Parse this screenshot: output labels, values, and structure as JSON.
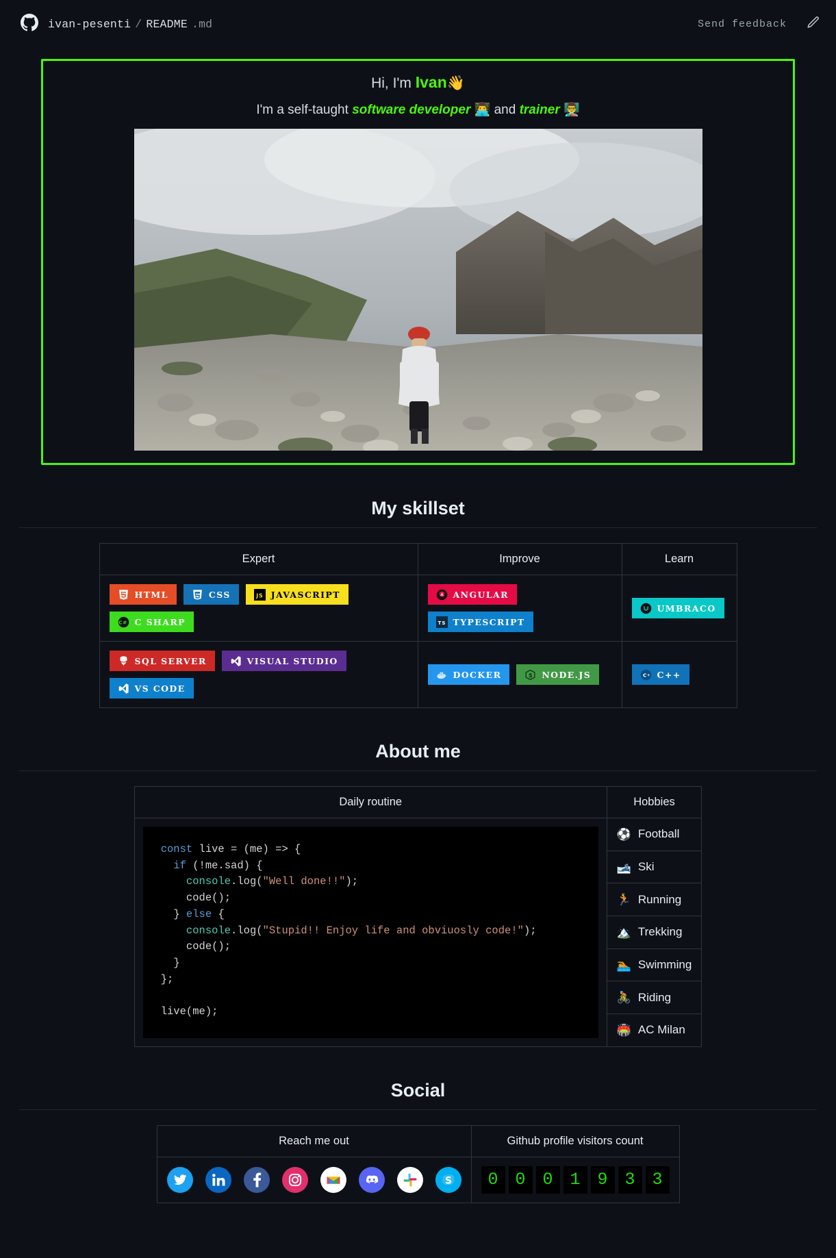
{
  "topbar": {
    "owner": "ivan-pesenti",
    "separator": "/",
    "file": "README",
    "ext": ".md",
    "feedback_label": "Send feedback",
    "logo_icon": "github-octocat-icon",
    "edit_icon": "pencil-icon"
  },
  "hero": {
    "border_color": "#4cf50a",
    "line1_prefix": "Hi, I'm ",
    "line1_name": "Ivan",
    "line1_emoji": "👋",
    "line2_prefix": "I'm a self-taught ",
    "line2_role1": "software developer",
    "line2_emoji1": "👨‍💻",
    "line2_mid": " and ",
    "line2_role2": "trainer",
    "line2_emoji2": "👨‍🏫",
    "photo_alt": "Ivan hiking on a rocky mountain slope with clouds and an alpine lake"
  },
  "skillset": {
    "title": "My skillset",
    "headers": [
      "Expert",
      "Improve",
      "Learn"
    ],
    "expert": [
      [
        {
          "label": "HTML",
          "bg": "#e44d26",
          "icon": "html5-icon"
        },
        {
          "label": "CSS",
          "bg": "#1572b6",
          "icon": "css3-icon"
        },
        {
          "label": "JAVASCRIPT",
          "bg": "#f7df1e",
          "fg": "#000000",
          "icon": "javascript-icon"
        },
        {
          "label": "C SHARP",
          "bg": "#3ddc1f",
          "icon": "csharp-icon"
        }
      ],
      [
        {
          "label": "SQL SERVER",
          "bg": "#cc2927",
          "icon": "sqlserver-icon"
        },
        {
          "label": "VISUAL STUDIO",
          "bg": "#5c2d91",
          "icon": "visualstudio-icon"
        },
        {
          "label": "VS CODE",
          "bg": "#0f80cc",
          "icon": "vscode-icon"
        }
      ]
    ],
    "improve": [
      [
        {
          "label": "ANGULAR",
          "bg": "#e50b45",
          "icon": "angular-icon"
        },
        {
          "label": "TYPESCRIPT",
          "bg": "#0f80cc",
          "icon": "typescript-icon"
        }
      ],
      [
        {
          "label": "DOCKER",
          "bg": "#2496ed",
          "icon": "docker-icon"
        },
        {
          "label": "NODE.JS",
          "bg": "#429945",
          "icon": "nodejs-icon"
        }
      ]
    ],
    "learn": [
      [
        {
          "label": "UMBRACO",
          "bg": "#0ac8c8",
          "icon": "umbraco-icon"
        }
      ],
      [
        {
          "label": "C++",
          "bg": "#1172b8",
          "icon": "cplusplus-icon"
        }
      ]
    ]
  },
  "about": {
    "title": "About me",
    "headers": [
      "Daily routine",
      "Hobbies"
    ],
    "code_lines": [
      {
        "t": "const",
        "c": "k",
        "rest": " live = (me) => {"
      },
      {
        "indent": "  ",
        "t": "if",
        "c": "k",
        "rest": " (!me.sad) {"
      },
      {
        "indent": "    ",
        "t": "console",
        "c": "fn",
        "rest": ".log(",
        "str": "\"Well done!!\"",
        "tail": ");"
      },
      {
        "indent": "    ",
        "plain": "code();"
      },
      {
        "indent": "  ",
        "plain": "} ",
        "t": "else",
        "c": "k",
        "rest": " {"
      },
      {
        "indent": "    ",
        "t": "console",
        "c": "fn",
        "rest": ".log(",
        "str": "\"Stupid!! Enjoy life and obviuosly code!\"",
        "tail": ");"
      },
      {
        "indent": "    ",
        "plain": "code();"
      },
      {
        "indent": "  ",
        "plain": "}"
      },
      {
        "plain": "};"
      },
      {
        "plain": ""
      },
      {
        "plain": "live(me);"
      }
    ],
    "code_text": "const live = (me) => {\n  if (!me.sad) {\n    console.log(\"Well done!!\");\n    code();\n  } else {\n    console.log(\"Stupid!! Enjoy life and obviuosly code!\");\n    code();\n  }\n};\n\nlive(me);",
    "hobbies": [
      {
        "emoji": "⚽",
        "label": "Football",
        "icon": "soccer-ball-icon"
      },
      {
        "emoji": "🎿",
        "label": "Ski",
        "icon": "ski-icon"
      },
      {
        "emoji": "🏃",
        "label": "Running",
        "icon": "runner-icon"
      },
      {
        "emoji": "🏔️",
        "label": "Trekking",
        "icon": "mountain-icon"
      },
      {
        "emoji": "🏊",
        "label": "Swimming",
        "icon": "swimmer-icon"
      },
      {
        "emoji": "🚴",
        "label": "Riding",
        "icon": "cyclist-icon"
      },
      {
        "emoji": "🏟️",
        "label": "AC Milan",
        "icon": "stadium-icon"
      }
    ]
  },
  "social": {
    "title": "Social",
    "headers": [
      "Reach me out",
      "Github profile visitors count"
    ],
    "links": [
      {
        "name": "twitter-icon",
        "bg": "#1da1f2"
      },
      {
        "name": "linkedin-icon",
        "bg": "#0a66c2"
      },
      {
        "name": "facebook-icon",
        "bg": "#3b5998"
      },
      {
        "name": "instagram-icon",
        "bg": "#e1306c"
      },
      {
        "name": "gmail-icon",
        "bg": "#ffffff"
      },
      {
        "name": "discord-icon",
        "bg": "#5865f2"
      },
      {
        "name": "slack-icon",
        "bg": "#ffffff"
      },
      {
        "name": "skype-icon",
        "bg": "#00aff0"
      }
    ],
    "visitors": [
      "0",
      "0",
      "0",
      "1",
      "9",
      "3",
      "3"
    ],
    "visitors_count": "0001933",
    "counter_color": "#23d916"
  }
}
